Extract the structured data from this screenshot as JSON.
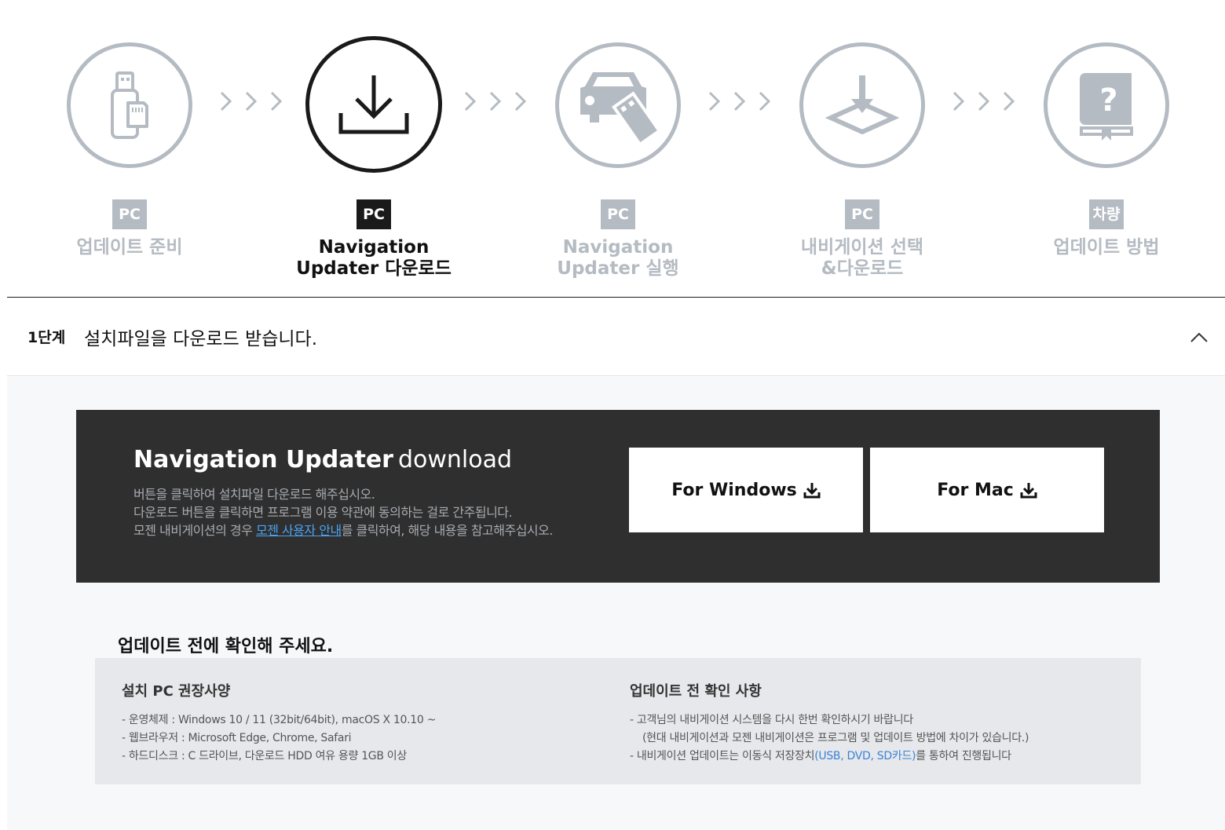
{
  "steps": [
    {
      "badge": "PC",
      "title": "업데이트 준비",
      "icon": "usb-sd-card-icon",
      "active": false
    },
    {
      "badge": "PC",
      "title": "Navigation\nUpdater 다운로드",
      "icon": "download-icon",
      "active": true
    },
    {
      "badge": "PC",
      "title": "Navigation\nUpdater 실행",
      "icon": "car-usb-icon",
      "active": false
    },
    {
      "badge": "PC",
      "title": "내비게이션 선택\n&다운로드",
      "icon": "map-download-icon",
      "active": false
    },
    {
      "badge": "차량",
      "title": "업데이트 방법",
      "icon": "help-book-icon",
      "active": false
    }
  ],
  "stage": {
    "number": "1단계",
    "title": "설치파일을 다운로드 받습니다."
  },
  "download": {
    "title_bold": "Navigation Updater",
    "title_light": "download",
    "desc_line1": "버튼을 클릭하여 설치파일 다운로드 해주십시오.",
    "desc_line2": "다운로드 버튼을 클릭하면 프로그램 이용 약관에 동의하는 걸로 간주됩니다.",
    "desc_line3_prefix": "모젠 내비게이션의 경우 ",
    "desc_line3_link": "모젠 사용자 안내",
    "desc_line3_suffix": "를 클릭하여, 해당 내용을 참고해주십시오.",
    "windows_label": "For Windows",
    "mac_label": "For Mac"
  },
  "check": {
    "title": "업데이트 전에 확인해 주세요.",
    "left_title": "설치 PC 권장사양",
    "left_items": [
      "- 운영체제 : Windows 10 / 11 (32bit/64bit), macOS X 10.10 ~",
      "- 웹브라우저 : Microsoft Edge, Chrome, Safari",
      "- 하드디스크 : C 드라이브, 다운로드 HDD 여유 용량 1GB 이상"
    ],
    "right_title": "업데이트 전 확인 사항",
    "right_item1": "- 고객님의 내비게이션 시스템을 다시 한번 확인하시기 바랍니다",
    "right_item2": "(현대 내비게이션과 모젠 내비게이션은 프로그램 및 업데이트 방법에 차이가 있습니다.)",
    "right_item3_prefix": "- 내비게이션 업데이트는 이동식 저장장치",
    "right_item3_highlight": "(USB, DVD, SD카드)",
    "right_item3_suffix": "를 통하여 진행됩니다"
  },
  "colors": {
    "inactive": "#b4bbc2",
    "active": "#1a1a1a",
    "dark_box": "#2f2f2f",
    "link": "#4aa3f0",
    "highlight": "#3b83d6"
  }
}
